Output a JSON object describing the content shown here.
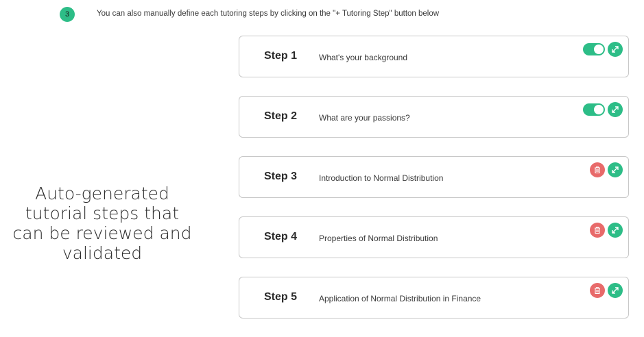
{
  "header": {
    "step_number": "3",
    "instruction": "You can also manually define each tutoring steps by clicking on the \"+ Tutoring Step\" button below"
  },
  "caption": {
    "lines": [
      "Auto-generated",
      "tutorial steps that",
      "can be reviewed and",
      "validated"
    ]
  },
  "steps": [
    {
      "label": "Step 1",
      "title": "What's your background",
      "control": "toggle",
      "toggle_on": true
    },
    {
      "label": "Step 2",
      "title": "What are your passions?",
      "control": "toggle",
      "toggle_on": true
    },
    {
      "label": "Step 3",
      "title": "Introduction to Normal Distribution",
      "control": "delete"
    },
    {
      "label": "Step 4",
      "title": "Properties of Normal Distribution",
      "control": "delete"
    },
    {
      "label": "Step 5",
      "title": "Application of Normal Distribution in Finance",
      "control": "delete"
    }
  ],
  "icons": {
    "toggle": "toggle-switch-icon",
    "delete": "trash-icon",
    "expand": "expand-arrows-icon"
  },
  "colors": {
    "accent_green": "#2dbd87",
    "delete_red": "#e86a6a",
    "card_border": "#c8c8c8"
  }
}
